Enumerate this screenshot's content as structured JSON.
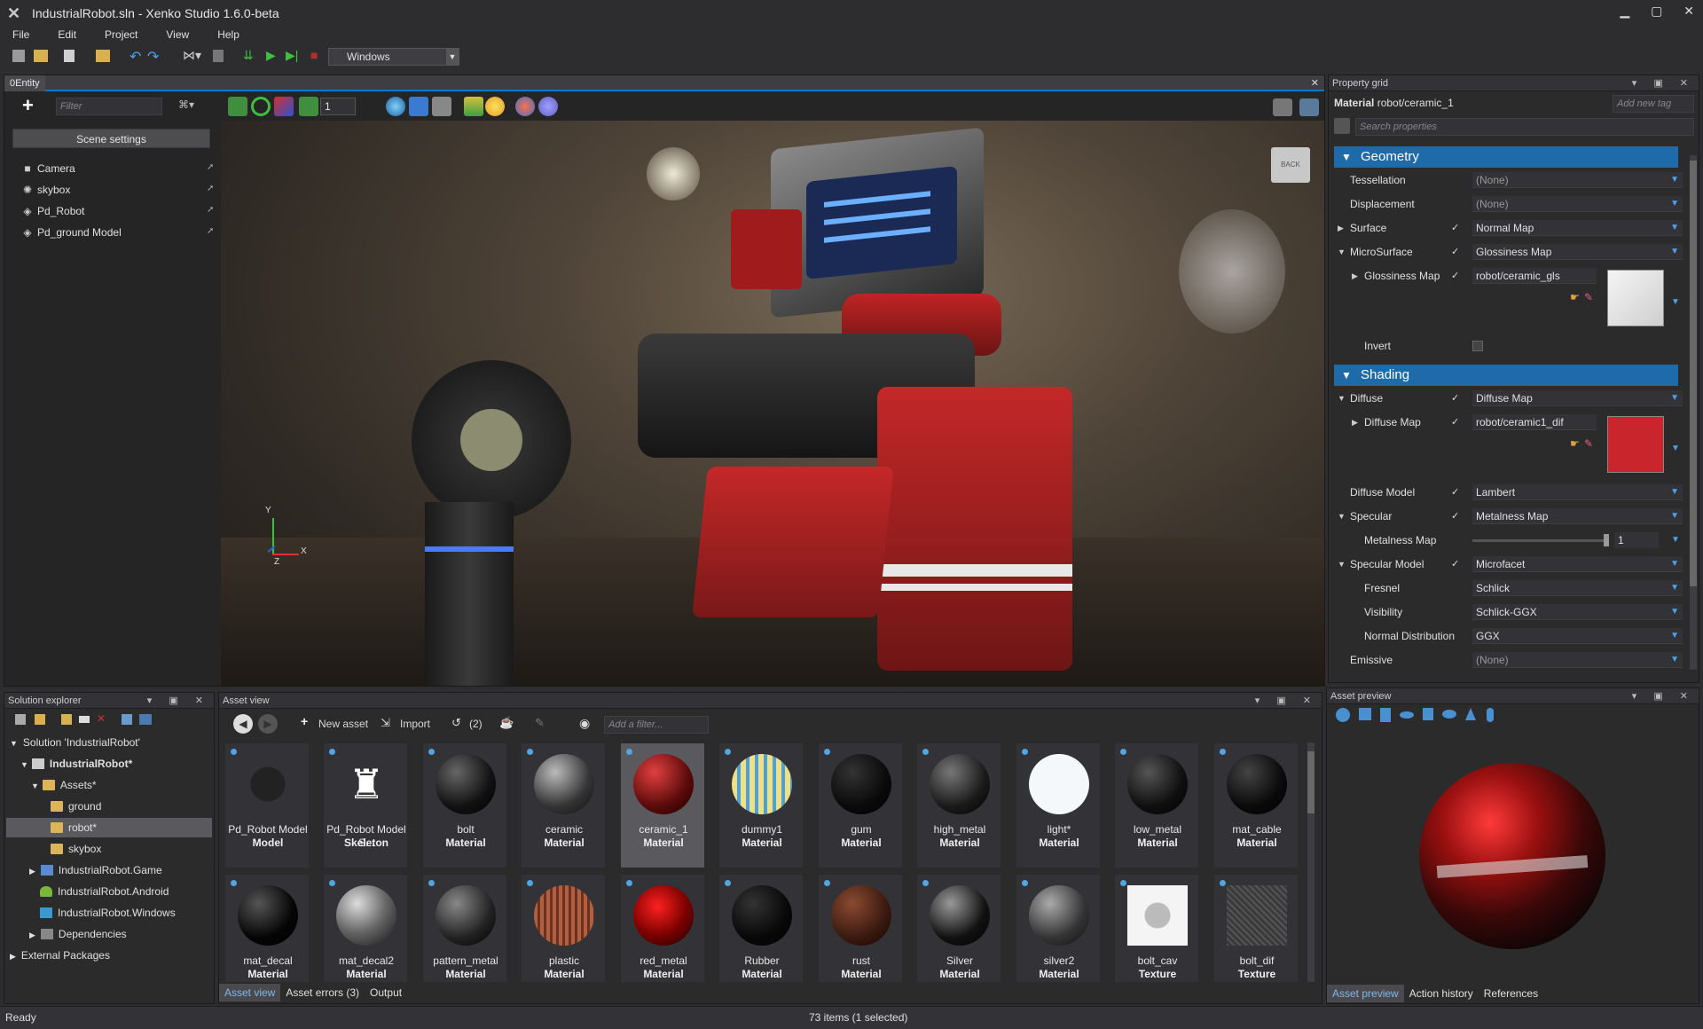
{
  "window": {
    "title": "IndustrialRobot.sln - Xenko Studio 1.6.0-beta"
  },
  "menu": [
    "File",
    "Edit",
    "Project",
    "View",
    "Help"
  ],
  "toolbar": {
    "platform": "Windows"
  },
  "scene": {
    "tab_label": "0Entity",
    "filter_placeholder": "Filter",
    "scene_settings_label": "Scene settings",
    "entities": [
      "Camera",
      "skybox",
      "Pd_Robot",
      "Pd_ground Model"
    ],
    "snap_value": "1",
    "gizmo_back_label": "BACK",
    "axis_y": "Y",
    "axis_x": "X",
    "axis_z": "Z"
  },
  "property_grid": {
    "title": "Property grid",
    "asset_type": "Material",
    "asset_path": "robot/ceramic_1",
    "add_tag_placeholder": "Add new tag",
    "search_placeholder": "Search properties",
    "geometry_header": "Geometry",
    "shading_header": "Shading",
    "rows": {
      "tessellation": {
        "label": "Tessellation",
        "value": "(None)"
      },
      "displacement": {
        "label": "Displacement",
        "value": "(None)"
      },
      "surface": {
        "label": "Surface",
        "value": "Normal Map"
      },
      "microsurface": {
        "label": "MicroSurface",
        "value": "Glossiness Map"
      },
      "glossiness_map": {
        "label": "Glossiness Map",
        "value": "robot/ceramic_gls"
      },
      "invert": {
        "label": "Invert"
      },
      "diffuse": {
        "label": "Diffuse",
        "value": "Diffuse Map"
      },
      "diffuse_map": {
        "label": "Diffuse Map",
        "value": "robot/ceramic1_dif"
      },
      "diffuse_model": {
        "label": "Diffuse Model",
        "value": "Lambert"
      },
      "specular": {
        "label": "Specular",
        "value": "Metalness Map"
      },
      "metalness_map": {
        "label": "Metalness Map",
        "value": "1"
      },
      "specular_model": {
        "label": "Specular Model",
        "value": "Microfacet"
      },
      "fresnel": {
        "label": "Fresnel",
        "value": "Schlick"
      },
      "visibility": {
        "label": "Visibility",
        "value": "Schlick-GGX"
      },
      "normal_distribution": {
        "label": "Normal Distribution",
        "value": "GGX"
      },
      "emissive": {
        "label": "Emissive",
        "value": "(None)"
      }
    },
    "diffuse_swatch_color": "#c8262c"
  },
  "solution": {
    "title": "Solution explorer",
    "items": {
      "solution": "Solution 'IndustrialRobot'",
      "project": "IndustrialRobot*",
      "assets": "Assets*",
      "ground": "ground",
      "robot": "robot*",
      "skybox": "skybox",
      "game": "IndustrialRobot.Game",
      "android": "IndustrialRobot.Android",
      "windows": "IndustrialRobot.Windows",
      "dependencies": "Dependencies",
      "external": "External Packages"
    }
  },
  "asset_view": {
    "title": "Asset view",
    "new_asset": "New asset",
    "import": "Import",
    "history_count": "(2)",
    "filter_placeholder": "Add a filter...",
    "assets": [
      {
        "name": "Pd_Robot Model",
        "type": "Model"
      },
      {
        "name": "Pd_Robot Model S...",
        "type": "Skeleton"
      },
      {
        "name": "bolt",
        "type": "Material"
      },
      {
        "name": "ceramic",
        "type": "Material"
      },
      {
        "name": "ceramic_1",
        "type": "Material"
      },
      {
        "name": "dummy1",
        "type": "Material"
      },
      {
        "name": "gum",
        "type": "Material"
      },
      {
        "name": "high_metal",
        "type": "Material"
      },
      {
        "name": "light*",
        "type": "Material"
      },
      {
        "name": "low_metal",
        "type": "Material"
      },
      {
        "name": "mat_cable",
        "type": "Material"
      },
      {
        "name": "mat_decal",
        "type": "Material"
      },
      {
        "name": "mat_decal2",
        "type": "Material"
      },
      {
        "name": "pattern_metal",
        "type": "Material"
      },
      {
        "name": "plastic",
        "type": "Material"
      },
      {
        "name": "red_metal",
        "type": "Material"
      },
      {
        "name": "Rubber",
        "type": "Material"
      },
      {
        "name": "rust",
        "type": "Material"
      },
      {
        "name": "Silver",
        "type": "Material"
      },
      {
        "name": "silver2",
        "type": "Material"
      },
      {
        "name": "bolt_cav",
        "type": "Texture"
      },
      {
        "name": "bolt_dif",
        "type": "Texture"
      }
    ],
    "tabs": [
      "Asset view",
      "Asset errors (3)",
      "Output"
    ]
  },
  "preview": {
    "title": "Asset preview",
    "tabs": [
      "Asset preview",
      "Action history",
      "References"
    ]
  },
  "status": {
    "left": "Ready",
    "center": "73 items (1 selected)"
  },
  "colors": {
    "accent": "#007acc",
    "category": "#1f6aa8",
    "selection": "#5a5a5e"
  }
}
